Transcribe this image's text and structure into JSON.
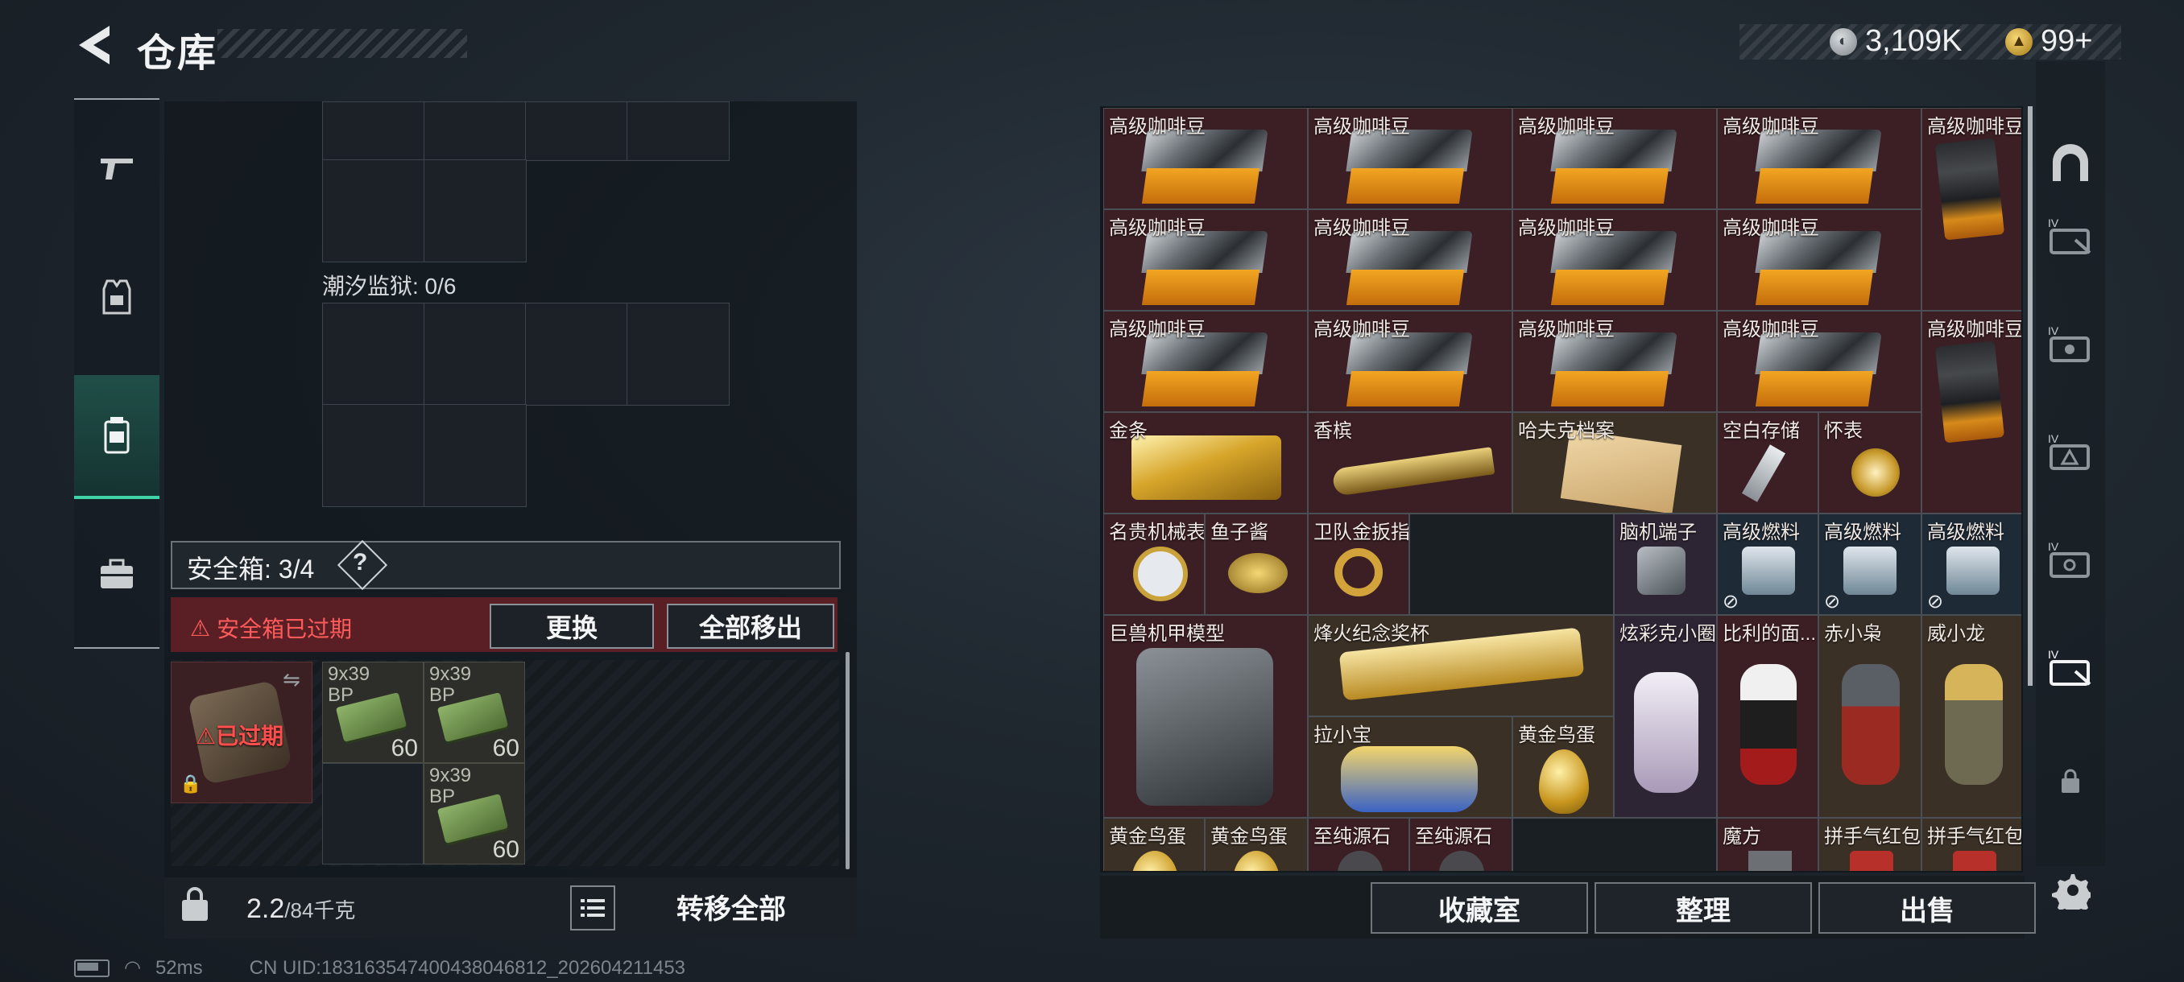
{
  "header": {
    "title": "仓库",
    "currency_silver": "3,109K",
    "currency_gold": "99+"
  },
  "left": {
    "prison_label": "潮汐监狱: 0/6",
    "safebox_label": "安全箱: 3/4",
    "help_label": "?",
    "expired_warning": "安全箱已过期",
    "replace_button": "更换",
    "move_all_out_button": "全部移出",
    "case_expired_label": "已过期",
    "ammo": [
      {
        "label": "9x39\nBP",
        "count": "60"
      },
      {
        "label": "9x39\nBP",
        "count": "60"
      },
      {
        "label": "9x39\nBP",
        "count": "60"
      }
    ],
    "weight_value": "2.2",
    "weight_max": "/84千克",
    "transfer_all_button": "转移全部"
  },
  "inventory": {
    "items": {
      "c1": "高级咖啡豆",
      "c2": "高级咖啡豆",
      "c3": "高级咖啡豆",
      "c4": "高级咖啡豆",
      "c5": "高级咖啡豆",
      "c6": "高级咖啡豆",
      "c7": "高级咖啡豆",
      "c8": "高级咖啡豆",
      "c9": "高级咖啡豆",
      "c10": "高级咖啡豆",
      "c11": "高级咖啡豆",
      "c12": "高级咖啡豆",
      "c13": "高级咖啡豆",
      "c14": "高级咖啡豆",
      "gold_bar": "金条",
      "champagne": "香槟",
      "dossier": "哈夫克档案",
      "usb": "空白存储",
      "pocket_watch": "怀表",
      "watch": "名贵机械表",
      "caviar": "鱼子酱",
      "ring": "卫队金扳指",
      "brain_port": "脑机端子",
      "fuel1": "高级燃料",
      "fuel2": "高级燃料",
      "fuel3": "高级燃料",
      "mech": "巨兽机甲模型",
      "trophy": "烽火纪念奖杯",
      "figure1": "炫彩克小圈",
      "figure2": "比利的面...",
      "figure3": "赤小枭",
      "figure4": "威小龙",
      "lion": "拉小宝",
      "egg": "黄金鸟蛋",
      "egg2": "黄金鸟蛋",
      "egg3": "黄金鸟蛋",
      "stone1": "至纯源石",
      "stone2": "至纯源石",
      "cube": "魔方",
      "hb1": "拼手气红包",
      "hb2": "拼手气红包"
    },
    "collection_button": "收藏室",
    "sort_button": "整理",
    "sell_button": "出售"
  },
  "status": {
    "ping": "52ms",
    "uid": "CN UID:18316354740043804681​2_202604211453"
  },
  "colors": {
    "accent": "#3fd3a8",
    "warning": "#ff5b5b",
    "rarity_red": "#3c1f25",
    "rarity_gold": "#3a3026"
  }
}
